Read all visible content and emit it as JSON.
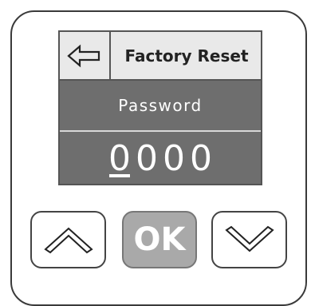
{
  "screen": {
    "title": "Factory Reset",
    "back_icon": "back-arrow-icon",
    "label": "Password",
    "digits": [
      "0",
      "0",
      "0",
      "0"
    ],
    "active_digit_index": 0
  },
  "buttons": {
    "up_icon": "chevron-up-icon",
    "ok_label": "OK",
    "down_icon": "chevron-down-icon"
  },
  "colors": {
    "screen_bg": "#6e6e6e",
    "header_bg": "#e9e9e9",
    "ok_button_bg": "#a9a9a9"
  }
}
